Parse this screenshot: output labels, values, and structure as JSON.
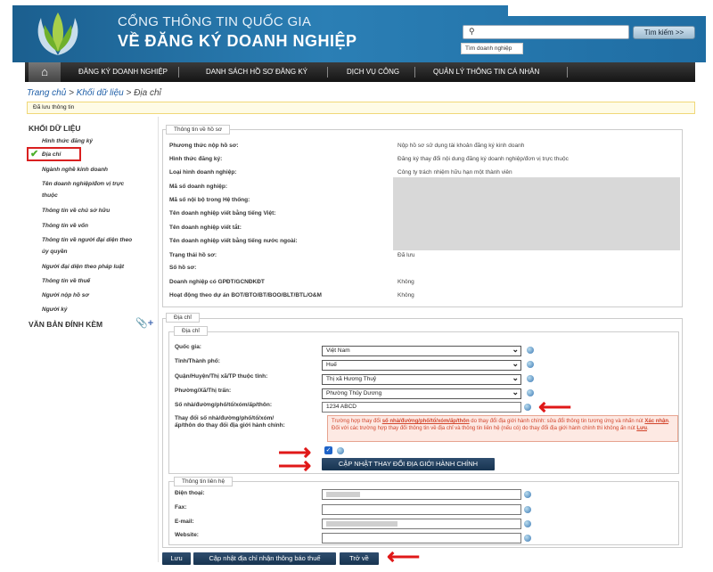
{
  "header": {
    "title_line1": "CỔNG THÔNG TIN QUỐC GIA",
    "title_line2": "VỀ ĐĂNG KÝ DOANH NGHIỆP",
    "search_placeholder": "",
    "search_button": "Tìm kiếm >>",
    "search_hint": "Tìm doanh nghiệp"
  },
  "nav": {
    "items": [
      "ĐĂNG KÝ DOANH NGHIỆP",
      "DANH SÁCH HỒ SƠ ĐĂNG KÝ",
      "DỊCH VỤ CÔNG",
      "QUẢN LÝ THÔNG TIN CÁ NHÂN"
    ]
  },
  "breadcrumb": {
    "home": "Trang chủ",
    "sep": " > ",
    "data": "Khối dữ liệu",
    "current": "Địa chỉ"
  },
  "saved_message": "Đã lưu thông tin",
  "sidebar": {
    "title": "KHỐI DỮ LIỆU",
    "items": [
      "Hình thức đăng ký",
      "Địa chỉ",
      "Ngành nghề kinh doanh",
      "Tên doanh nghiệp/đơn vị trực",
      "thuộc",
      "Thông tin về chủ sở hữu",
      "Thông tin về vốn",
      "Thông tin về người đại diện theo",
      "ủy quyền",
      "Người đại diện theo pháp luật",
      "Thông tin về thuế",
      "Người nộp hồ sơ",
      "Người ký"
    ],
    "attach_title": "VĂN BẢN ĐÍNH KÈM"
  },
  "dossier": {
    "legend": "Thông tin về hồ sơ",
    "rows": [
      {
        "label": "Phương thức nộp hồ sơ:",
        "value": "Nộp hồ sơ sử dụng tài khoản đăng ký kinh doanh"
      },
      {
        "label": "Hình thức đăng ký:",
        "value": "Đăng ký thay đổi nội dung đăng ký doanh nghiệp/đơn vị trực thuộc"
      },
      {
        "label": "Loại hình doanh nghiệp:",
        "value": "Công ty trách nhiệm hữu hạn một thành viên"
      },
      {
        "label": "Mã số doanh nghiệp:",
        "value": ""
      },
      {
        "label": "Mã số nội bộ trong Hệ thống:",
        "value": ""
      },
      {
        "label": "Tên doanh nghiệp viết bằng tiếng Việt:",
        "value": ""
      },
      {
        "label": "Tên doanh nghiệp viết tắt:",
        "value": ""
      },
      {
        "label": "Tên doanh nghiệp viết bằng tiếng nước ngoài:",
        "value": ""
      },
      {
        "label": "Trạng thái hồ sơ:",
        "value": "Đã lưu"
      },
      {
        "label": "Số hồ sơ:",
        "value": ""
      },
      {
        "label": "Doanh nghiệp có GPĐT/GCNĐKĐT",
        "value": "Không"
      },
      {
        "label": "Hoạt động theo dự án BOT/BTO/BT/BOO/BLT/BTL/O&M",
        "value": "Không"
      }
    ]
  },
  "address": {
    "outer_legend": "Địa chỉ",
    "inner_legend": "Địa chỉ",
    "country_label": "Quốc gia:",
    "country": "Việt Nam",
    "province_label": "Tỉnh/Thành phố:",
    "province": "Huế",
    "district_label": "Quận/Huyện/Thị xã/TP thuộc tỉnh:",
    "district": "Thị xã Hương Thuỷ",
    "ward_label": "Phường/Xã/Thị trấn:",
    "ward": "Phường Thủy Dương",
    "street_label": "Số nhà/đường/phố/tổ/xóm/ấp/thôn:",
    "street": "1234 ABCD",
    "change_label_1": "Thay đổi số nhà/đường/phố/tổ/xóm/",
    "change_label_2": "ấp/thôn do thay đổi địa giới hành chính:",
    "warn_1": "Trường hợp thay đổi ",
    "warn_bold_1": "số nhà/đường/phố/tổ/xóm/ấp/thôn",
    "warn_2": " do thay đổi địa giới hành chính: sửa đổi thông tin tương ứng và nhấn nút ",
    "warn_bold_2": "Xác nhận",
    "warn_3": ". Đối với các trường hợp thay đổi thông tin về địa chỉ và thông tin liên hệ (nếu có) do thay đổi địa giới hành chính thì không ấn nút ",
    "warn_bold_3": "Lưu",
    "warn_4": ".",
    "update_button": "CẬP NHẬT THAY ĐỔI ĐỊA GIỚI HÀNH CHÍNH"
  },
  "contact": {
    "legend": "Thông tin liên hệ",
    "phone_label": "Điện thoại:",
    "fax_label": "Fax:",
    "email_label": "E-mail:",
    "website_label": "Website:"
  },
  "footer": {
    "save": "Lưu",
    "update_notice": "Cập nhật địa chỉ nhận thông báo thuế",
    "back": "Trở về"
  }
}
